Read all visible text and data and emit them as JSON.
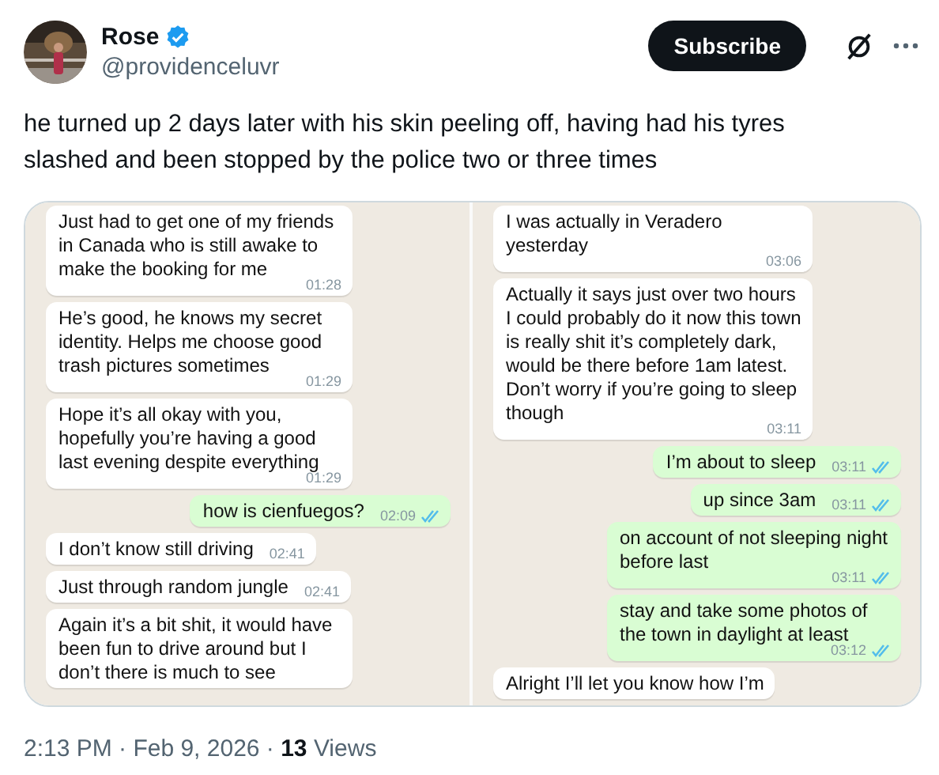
{
  "author": {
    "name": "Rose",
    "verified": true,
    "handle": "@providenceluvr"
  },
  "subscribe_button": "Subscribe",
  "text": "he turned up 2 days later with his skin peeling off, having had his tyres slashed and been stopped by the police two or three times",
  "panels": [
    {
      "messages": [
        {
          "kind": "in",
          "text": "Just had to get one of my friends in Canada who is still awake to make the booking for me",
          "time": "01:28"
        },
        {
          "kind": "in",
          "text": "He’s good, he knows my secret identity. Helps me choose good trash pictures sometimes",
          "time": "01:29"
        },
        {
          "kind": "in",
          "text": "Hope it’s all okay with you, hopefully you’re having a good last evening despite everything",
          "time": "01:29"
        },
        {
          "kind": "out",
          "text": "how is cienfuegos?",
          "time": "02:09",
          "read": true
        },
        {
          "kind": "in",
          "text": "I don’t know still driving",
          "time": "02:41"
        },
        {
          "kind": "in",
          "text": "Just through random jungle",
          "time": "02:41"
        },
        {
          "kind": "in",
          "text": "Again it’s a bit shit, it would have been fun to drive around but I don’t there is much to see"
        }
      ]
    },
    {
      "messages": [
        {
          "kind": "in",
          "text": "I was actually in Veradero yesterday",
          "time": "03:06"
        },
        {
          "kind": "in",
          "text": "Actually it says just over two hours I could probably do it now this town is really shit it’s completely dark, would be there before 1am latest. Don’t worry if you’re going to sleep though",
          "time": "03:11"
        },
        {
          "kind": "out",
          "text": "I’m about to sleep",
          "time": "03:11",
          "read": true
        },
        {
          "kind": "out",
          "text": "up since 3am",
          "time": "03:11",
          "read": true
        },
        {
          "kind": "out",
          "text": "on account of not sleeping night before last",
          "time": "03:11",
          "read": true
        },
        {
          "kind": "out",
          "text": "stay and take some photos of the town in daylight at least",
          "time": "03:12",
          "read": true
        },
        {
          "kind": "in",
          "text": "Alright I’ll let you know how I’m"
        }
      ]
    }
  ],
  "footer": "2:13 PM · Feb 9, 2026 · **13** Views"
}
